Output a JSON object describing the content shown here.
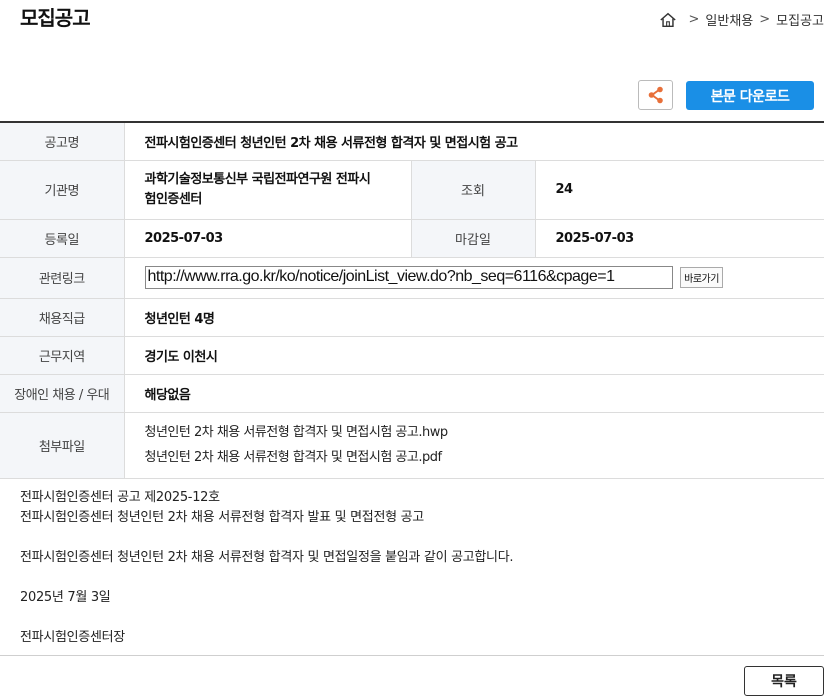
{
  "page": {
    "title": "모집공고"
  },
  "breadcrumb": {
    "home_icon": "home-icon",
    "items": [
      "일반채용",
      "모집공고"
    ],
    "separator": ">"
  },
  "toolbar": {
    "share_icon": "share-icon",
    "download_label": "본문 다운로드",
    "accent": "#1a8fe6"
  },
  "info": {
    "title_label": "공고명",
    "title_value": "전파시험인증센터 청년인턴 2차 채용 서류전형 합격자 및 면접시험 공고",
    "org_label": "기관명",
    "org_value_line1": "과학기술정보통신부 국립전파연구원 전파시",
    "org_value_line2": "험인증센터",
    "views_label": "조회",
    "views_value": "24",
    "reg_label": "등록일",
    "reg_value": "2025-07-03",
    "deadline_label": "마감일",
    "deadline_value": "2025-07-03",
    "link_label": "관련링크",
    "link_value": "http://www.rra.go.kr/ko/notice/joinList_view.do?nb_seq=6116&cpage=1",
    "link_go_label": "바로가기",
    "position_label": "채용직급",
    "position_value": "청년인턴 4명",
    "location_label": "근무지역",
    "location_value": "경기도 이천시",
    "disability_label": "장애인 채용 / 우대",
    "disability_value": "해당없음",
    "files_label": "첨부파일",
    "files": [
      "청년인턴 2차 채용 서류전형 합격자 및 면접시험 공고.hwp",
      "청년인턴 2차 채용 서류전형 합격자 및 면접시험 공고.pdf"
    ]
  },
  "content": {
    "line1": "전파시험인증센터 공고 제2025-12호",
    "line2": "전파시험인증센터 청년인턴 2차 채용 서류전형 합격자 발표 및 면접전형 공고",
    "line3": "전파시험인증센터 청년인턴 2차 채용 서류전형 합격자 및 면접일정을 붙임과 같이 공고합니다.",
    "line4": "2025년 7월 3일",
    "line5": "전파시험인증센터장"
  },
  "footer": {
    "list_label": "목록"
  }
}
